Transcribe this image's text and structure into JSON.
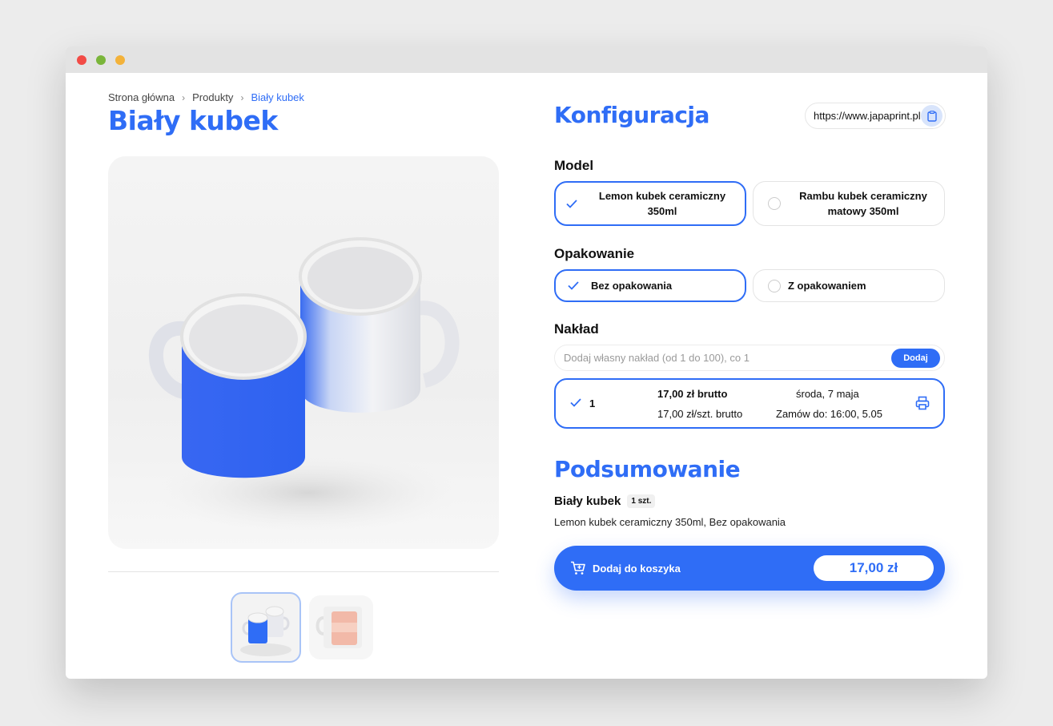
{
  "breadcrumb": {
    "home": "Strona główna",
    "products": "Produkty",
    "current": "Biały kubek"
  },
  "product": {
    "title": "Biały kubek"
  },
  "config": {
    "title": "Konfiguracja",
    "url": "https://www.japaprint.pl",
    "model_label": "Model",
    "models": [
      {
        "label": "Lemon kubek ceramiczny 350ml",
        "selected": true
      },
      {
        "label": "Rambu kubek ceramiczny matowy 350ml",
        "selected": false
      }
    ],
    "packaging_label": "Opakowanie",
    "packaging": [
      {
        "label": "Bez opakowania",
        "selected": true
      },
      {
        "label": "Z opakowaniem",
        "selected": false
      }
    ],
    "quantity_label": "Nakład",
    "quantity_placeholder": "Dodaj własny nakład (od 1 do 100), co 1",
    "add_button": "Dodaj",
    "quantity_row": {
      "qty": "1",
      "total": "17,00 zł brutto",
      "unit": "17,00 zł/szt. brutto",
      "date": "środa, 7 maja",
      "deadline": "Zamów do: 16:00, 5.05"
    }
  },
  "summary": {
    "title": "Podsumowanie",
    "name": "Biały kubek",
    "qty_badge": "1 szt.",
    "description": "Lemon kubek ceramiczny 350ml, Bez opakowania",
    "cart_label": "Dodaj do koszyka",
    "price": "17,00 zł"
  },
  "colors": {
    "accent": "#2f6df6",
    "accent_light": "#d8e4fb"
  },
  "icons": [
    "check-icon",
    "clipboard-icon",
    "printer-icon",
    "cart-icon",
    "chevron-right-icon"
  ]
}
